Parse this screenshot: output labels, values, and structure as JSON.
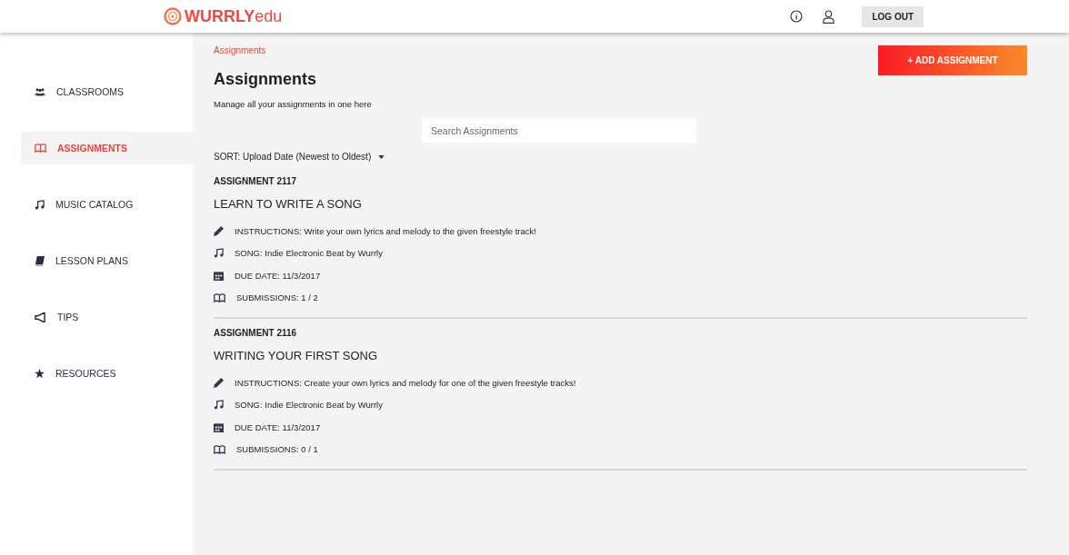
{
  "header": {
    "logo": "**WURRLY**edu",
    "logout": "LOG OUT"
  },
  "sidebar": {
    "items": [
      {
        "label": "CLASSROOMS",
        "kind": "classrooms",
        "selected": false
      },
      {
        "label": "ASSIGNMENTS",
        "kind": "assignments",
        "selected": true
      },
      {
        "label": "MUSIC CATALOG",
        "kind": "music",
        "selected": false
      },
      {
        "label": "LESSON PLANS",
        "kind": "lessons",
        "selected": false
      },
      {
        "label": "TIPS",
        "kind": "tips",
        "selected": false
      },
      {
        "label": "RESOURCES",
        "kind": "resources",
        "selected": false
      }
    ]
  },
  "breadcrumb": "Assignments",
  "add_button": "+ ADD ASSIGNMENT",
  "title": "Assignments",
  "subtitle": "Manage all your assignments in one here",
  "search": {
    "placeholder": "Search Assignments"
  },
  "sort": "SORT: Upload Date (Newest to Oldest)",
  "assignments": [
    {
      "number": "ASSIGNMENT 2117",
      "name": "LEARN TO WRITE A SONG",
      "details": [
        {
          "kind": "instructions",
          "text": "INSTRUCTIONS: Write your own lyrics and melody to the given freestyle track!"
        },
        {
          "kind": "song",
          "text": "SONG: Indie Electronic Beat by Wurrly"
        },
        {
          "kind": "due",
          "text": "DUE DATE: 11/3/2017"
        },
        {
          "kind": "submissions",
          "text": "SUBMISSIONS: 1 / 2"
        }
      ]
    },
    {
      "number": "ASSIGNMENT 2116",
      "name": "WRITING YOUR FIRST SONG",
      "details": [
        {
          "kind": "instructions",
          "text": "INSTRUCTIONS: Create your own lyrics and melody for one of the given freestyle tracks!"
        },
        {
          "kind": "song",
          "text": "SONG: Indie Electronic Beat by Wurrly"
        },
        {
          "kind": "due",
          "text": "DUE DATE: 11/3/2017"
        },
        {
          "kind": "submissions",
          "text": "SUBMISSIONS: 0 / 1"
        }
      ]
    }
  ]
}
